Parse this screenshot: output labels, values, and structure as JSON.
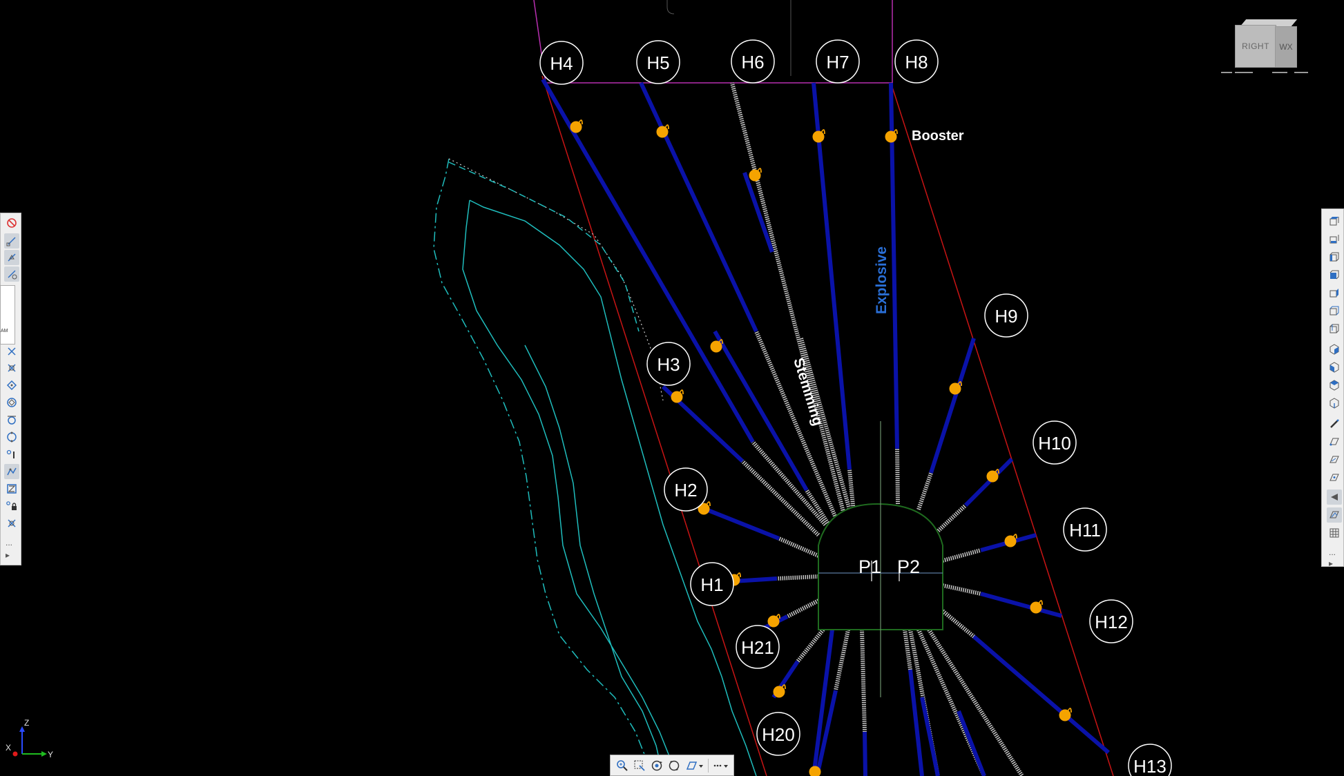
{
  "holes": {
    "h1": "H1",
    "h2": "H2",
    "h3": "H3",
    "h4": "H4",
    "h5": "H5",
    "h6": "H6",
    "h7": "H7",
    "h8": "H8",
    "h9": "H9",
    "h10": "H10",
    "h11": "H11",
    "h12": "H12",
    "h13": "H13",
    "h20": "H20",
    "h21": "H21"
  },
  "annotations": {
    "booster": "Booster",
    "explosive": "Explosive",
    "stemming": "Stemming",
    "p1": "P1",
    "p2": "P2"
  },
  "viewcube": {
    "front": "RIGHT",
    "side": "WX"
  },
  "ucs": {
    "z": "Z",
    "y": "Y",
    "x": "X"
  },
  "left_flyout_text": "AM",
  "toolbar_more": "...",
  "colors": {
    "background": "#000000",
    "charge": "#0a12a8",
    "stemming": "#c8c8c8",
    "booster": "#f5a300",
    "limit_line": "#c81414",
    "boundary": "#b82fb0",
    "contour": "#1fbdbd",
    "tunnel": "#1f6b1f",
    "explosive_label": "#2a6fd6",
    "hole_label": "#ffffff"
  }
}
